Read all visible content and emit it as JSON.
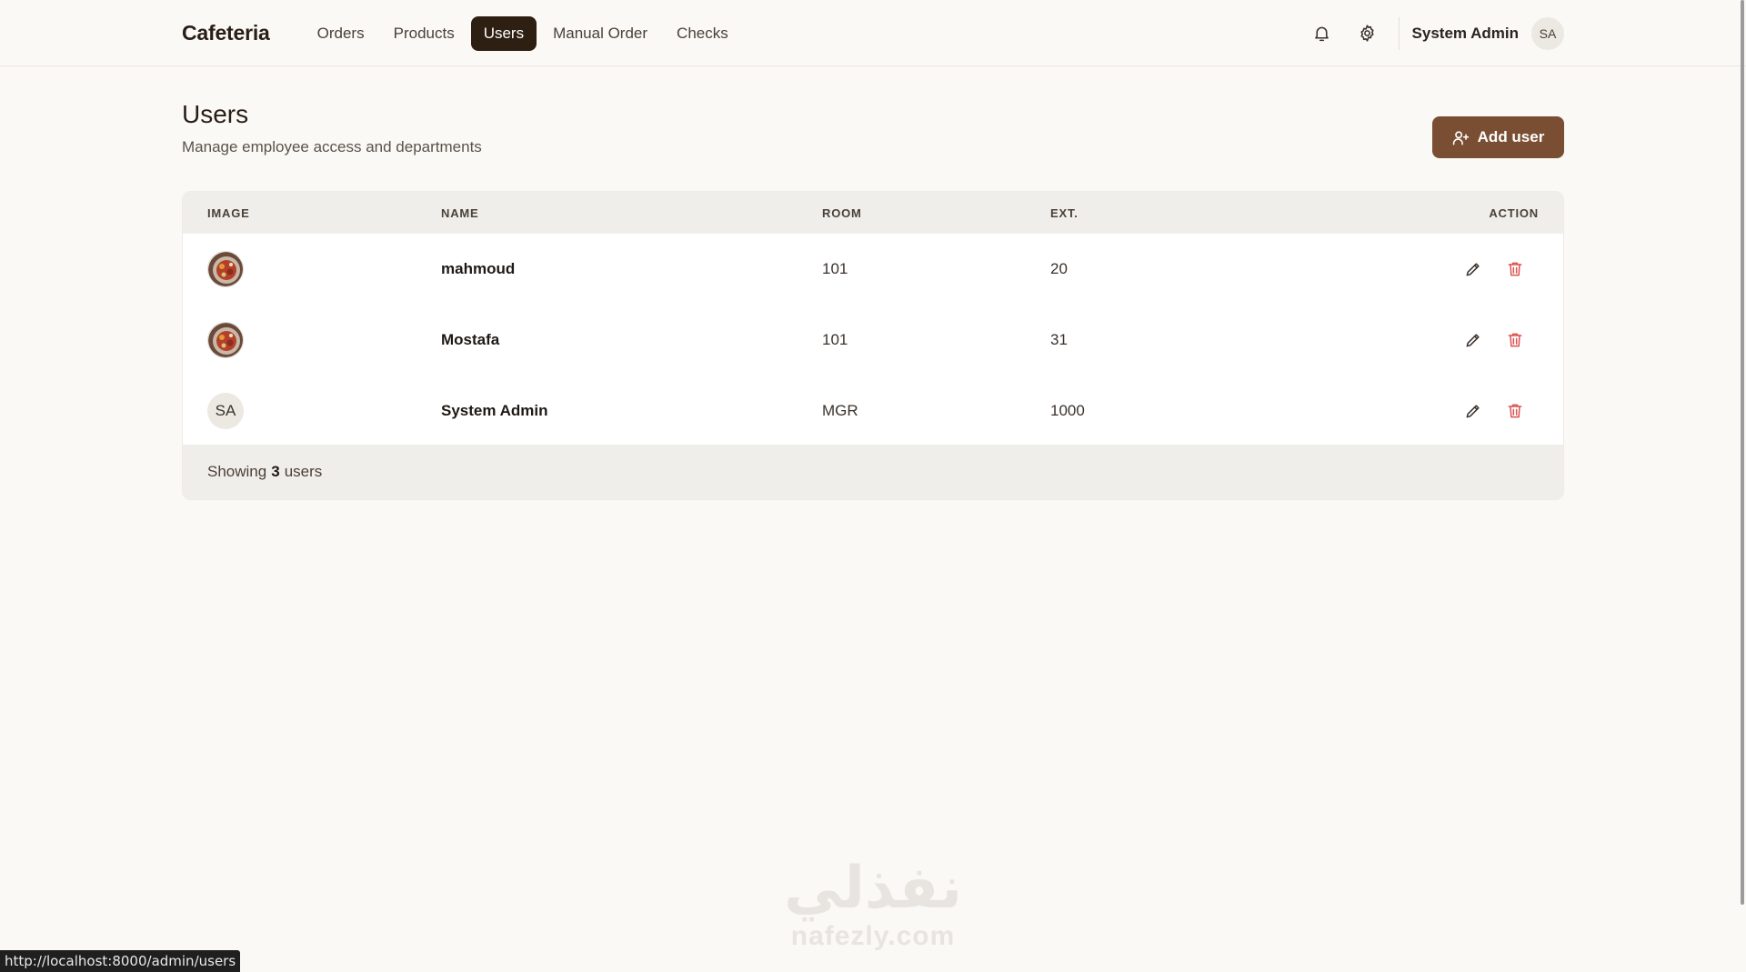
{
  "header": {
    "brand": "Cafeteria",
    "nav": [
      {
        "label": "Orders",
        "active": false
      },
      {
        "label": "Products",
        "active": false
      },
      {
        "label": "Users",
        "active": true
      },
      {
        "label": "Manual Order",
        "active": false
      },
      {
        "label": "Checks",
        "active": false
      }
    ],
    "icons": [
      "bell-icon",
      "gear-icon"
    ],
    "user_name": "System Admin",
    "user_initials": "SA"
  },
  "page": {
    "title": "Users",
    "subtitle": "Manage employee access and departments",
    "add_button": "Add user"
  },
  "table": {
    "columns": [
      "IMAGE",
      "NAME",
      "ROOM",
      "EXT.",
      "ACTION"
    ],
    "rows": [
      {
        "image": "food-photo",
        "initials": "",
        "name": "mahmoud",
        "room": "101",
        "ext": "20"
      },
      {
        "image": "food-photo",
        "initials": "",
        "name": "Mostafa",
        "room": "101",
        "ext": "31"
      },
      {
        "image": "",
        "initials": "SA",
        "name": "System Admin",
        "room": "MGR",
        "ext": "1000"
      }
    ],
    "footer_prefix": "Showing",
    "footer_count": "3",
    "footer_suffix": "users"
  },
  "watermark": {
    "arabic": "نفذلي",
    "latin": "nafezly.com"
  },
  "status_url": "http://localhost:8000/admin/users",
  "colors": {
    "accent": "#7a4e33",
    "nav_active": "#2e1f13",
    "danger": "#d9534f"
  }
}
